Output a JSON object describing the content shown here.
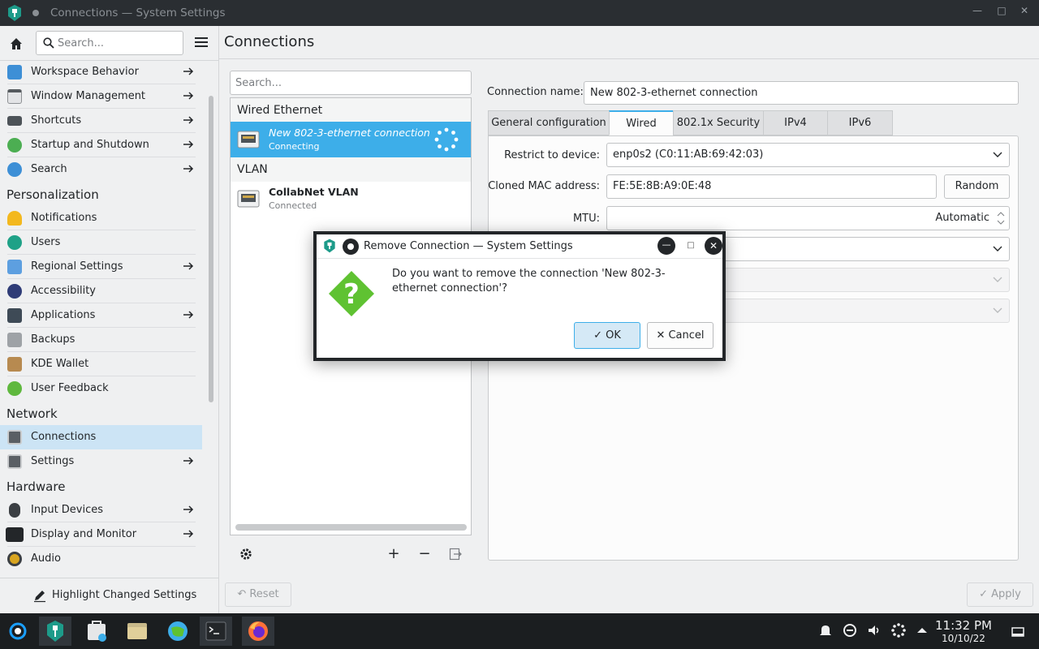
{
  "window": {
    "title": "Connections — System Settings"
  },
  "sidebar": {
    "search_placeholder": "Search...",
    "items": [
      {
        "label": "Workspace Behavior"
      },
      {
        "label": "Window Management"
      },
      {
        "label": "Shortcuts"
      },
      {
        "label": "Startup and Shutdown"
      },
      {
        "label": "Search"
      },
      {
        "label": "Notifications"
      },
      {
        "label": "Users"
      },
      {
        "label": "Regional Settings"
      },
      {
        "label": "Accessibility"
      },
      {
        "label": "Applications"
      },
      {
        "label": "Backups"
      },
      {
        "label": "KDE Wallet"
      },
      {
        "label": "User Feedback"
      },
      {
        "label": "Connections"
      },
      {
        "label": "Settings"
      },
      {
        "label": "Input Devices"
      },
      {
        "label": "Display and Monitor"
      },
      {
        "label": "Audio"
      }
    ],
    "categories": [
      "Personalization",
      "Network",
      "Hardware"
    ],
    "footer_label": "Highlight Changed Settings"
  },
  "main": {
    "title": "Connections",
    "list_search_placeholder": "Search...",
    "groups": [
      {
        "header": "Wired Ethernet",
        "name": "New 802-3-ethernet connection",
        "status": "Connecting"
      },
      {
        "header": "VLAN",
        "name": "CollabNet VLAN",
        "status": "Connected"
      }
    ],
    "connection_name_label": "Connection name:",
    "connection_name_value": "New 802-3-ethernet connection",
    "tabs": [
      "General configuration",
      "Wired",
      "802.1x Security",
      "IPv4",
      "IPv6"
    ],
    "active_tab": "Wired",
    "fields": {
      "restrict_label": "Restrict to device:",
      "restrict_value": "enp0s2 (C0:11:AB:69:42:03)",
      "mac_label": "Cloned MAC address:",
      "mac_value": "FE:5E:8B:A9:0E:48",
      "random_label": "Random",
      "mtu_label": "MTU:",
      "mtu_value": "Automatic"
    },
    "reset_label": "Reset",
    "apply_label": "Apply"
  },
  "dialog": {
    "title": "Remove Connection — System Settings",
    "message": "Do you want to remove the connection 'New 802-3-ethernet connection'?",
    "ok_label": "OK",
    "cancel_label": "Cancel"
  },
  "taskbar": {
    "time": "11:32 PM",
    "date": "10/10/22"
  },
  "colors": {
    "accent": "#3daee9",
    "selection": "#cce4f5",
    "taskbar": "#1b1e20"
  }
}
